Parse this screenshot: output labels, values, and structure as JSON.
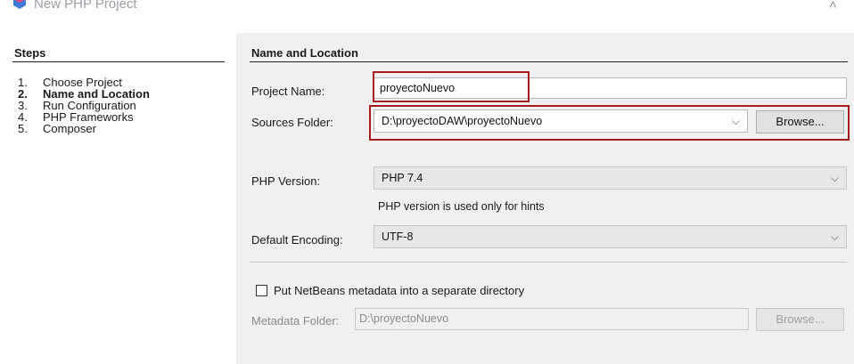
{
  "window": {
    "title": "New PHP Project"
  },
  "steps": {
    "heading": "Steps",
    "items": [
      {
        "num": "1.",
        "label": "Choose Project"
      },
      {
        "num": "2.",
        "label": "Name and Location"
      },
      {
        "num": "3.",
        "label": "Run Configuration"
      },
      {
        "num": "4.",
        "label": "PHP Frameworks"
      },
      {
        "num": "5.",
        "label": "Composer"
      }
    ],
    "active_index": 1
  },
  "section": {
    "title": "Name and Location"
  },
  "form": {
    "project_name": {
      "label": "Project Name:",
      "value": "proyectoNuevo"
    },
    "sources_folder": {
      "label": "Sources Folder:",
      "value": "D:\\proyectoDAW\\proyectoNuevo",
      "browse_label": "Browse..."
    },
    "php_version": {
      "label": "PHP Version:",
      "value": "PHP 7.4",
      "hint": "PHP version is used only for hints"
    },
    "default_encoding": {
      "label": "Default Encoding:",
      "value": "UTF-8"
    },
    "metadata_checkbox": {
      "label": "Put NetBeans metadata into a separate directory",
      "checked": false
    },
    "metadata_folder": {
      "label": "Metadata Folder:",
      "value": "D:\\proyectoNuevo",
      "browse_label": "Browse..."
    }
  },
  "icons": {
    "chevron": "⌵",
    "collapse": "˄"
  },
  "colors": {
    "highlight": "#a61b1b",
    "panel_bg": "#f0f0f0",
    "app_icon": "#3d7bd6"
  }
}
